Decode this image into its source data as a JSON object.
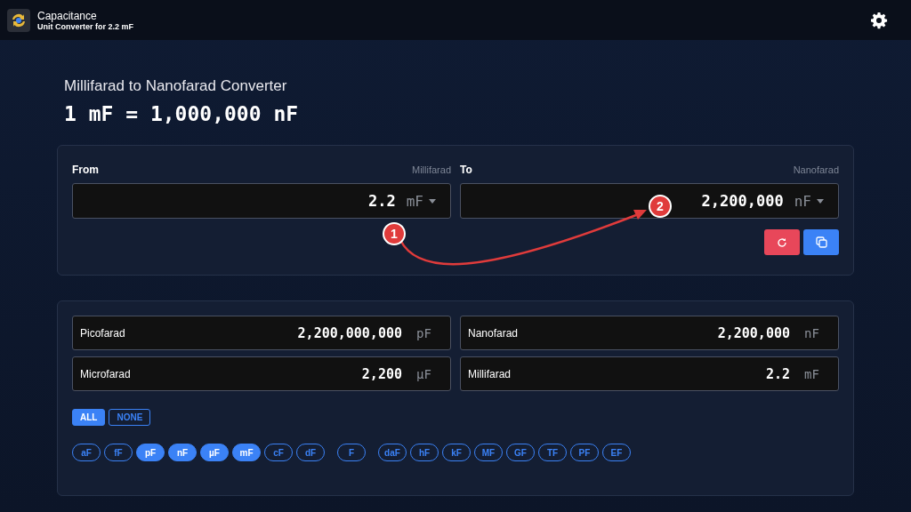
{
  "header": {
    "title": "Capacitance",
    "subtitle": "Unit Converter for 2.2 mF"
  },
  "heading": "Millifarad to Nanofarad Converter",
  "formula": "1 mF = 1,000,000 nF",
  "from": {
    "label": "From",
    "unit_name": "Millifarad",
    "value": "2.2",
    "unit": "mF"
  },
  "to": {
    "label": "To",
    "unit_name": "Nanofarad",
    "value": "2,200,000",
    "unit": "nF"
  },
  "results": [
    {
      "name": "Picofarad",
      "value": "2,200,000,000",
      "unit": "pF"
    },
    {
      "name": "Nanofarad",
      "value": "2,200,000",
      "unit": "nF"
    },
    {
      "name": "Microfarad",
      "value": "2,200",
      "unit": "µF"
    },
    {
      "name": "Millifarad",
      "value": "2.2",
      "unit": "mF"
    }
  ],
  "filter_buttons": [
    {
      "label": "ALL",
      "selected": true
    },
    {
      "label": "NONE",
      "selected": false
    }
  ],
  "unit_groups": [
    [
      {
        "label": "aF",
        "selected": false
      },
      {
        "label": "fF",
        "selected": false
      },
      {
        "label": "pF",
        "selected": true
      },
      {
        "label": "nF",
        "selected": true
      },
      {
        "label": "µF",
        "selected": true
      },
      {
        "label": "mF",
        "selected": true
      },
      {
        "label": "cF",
        "selected": false
      },
      {
        "label": "dF",
        "selected": false
      }
    ],
    [
      {
        "label": "F",
        "selected": false
      }
    ],
    [
      {
        "label": "daF",
        "selected": false
      },
      {
        "label": "hF",
        "selected": false
      },
      {
        "label": "kF",
        "selected": false
      },
      {
        "label": "MF",
        "selected": false
      },
      {
        "label": "GF",
        "selected": false
      },
      {
        "label": "TF",
        "selected": false
      },
      {
        "label": "PF",
        "selected": false
      },
      {
        "label": "EF",
        "selected": false
      }
    ]
  ],
  "annotations": [
    "1",
    "2"
  ]
}
